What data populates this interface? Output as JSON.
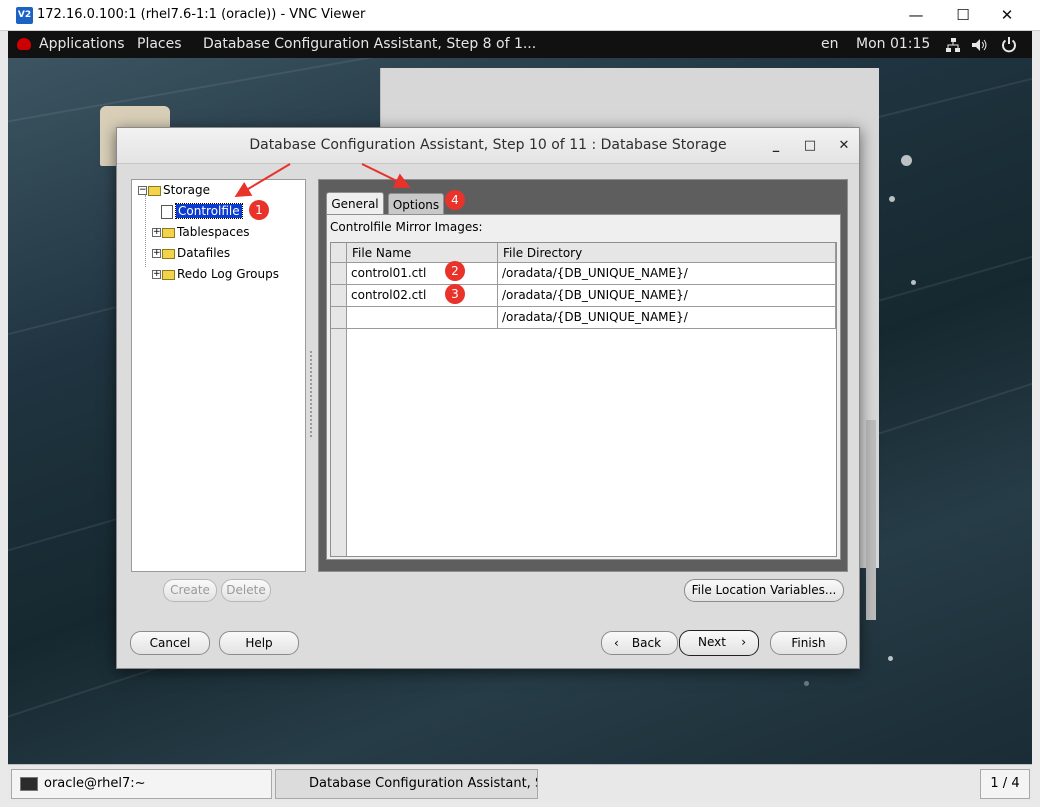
{
  "vnc": {
    "logo": "V2",
    "title": "172.16.0.100:1 (rhel7.6-1:1 (oracle)) - VNC Viewer",
    "controls": {
      "minimize": "—",
      "maximize": "☐",
      "close": "✕"
    }
  },
  "gnome": {
    "applications": "Applications",
    "places": "Places",
    "active_window": "Database Configuration Assistant, Step 8 of 1...",
    "lang": "en",
    "clock": "Mon 01:15",
    "icons": [
      "network-icon",
      "volume-icon",
      "power-icon"
    ]
  },
  "dialog": {
    "title": "Database Configuration Assistant, Step 10 of 11 : Database Storage",
    "controls": {
      "minimize": "_",
      "maximize": "□",
      "close": "✕"
    },
    "tree": {
      "root": "Storage",
      "items": [
        "Controlfile",
        "Tablespaces",
        "Datafiles",
        "Redo Log Groups"
      ]
    },
    "buttons": {
      "create": "Create",
      "delete": "Delete",
      "file_location": "File Location Variables...",
      "cancel": "Cancel",
      "help": "Help",
      "back": "Back",
      "next": "Next",
      "finish": "Finish"
    },
    "tabs": [
      "General",
      "Options"
    ],
    "mirror_label": "Controlfile Mirror Images:",
    "grid": {
      "columns": [
        "File Name",
        "File Directory"
      ],
      "rows": [
        {
          "name": "control01.ctl",
          "dir": "/oradata/{DB_UNIQUE_NAME}/"
        },
        {
          "name": "control02.ctl",
          "dir": "/oradata/{DB_UNIQUE_NAME}/"
        },
        {
          "name": "",
          "dir": "/oradata/{DB_UNIQUE_NAME}/"
        }
      ]
    }
  },
  "annotations": {
    "badges": [
      "1",
      "2",
      "3",
      "4"
    ],
    "color": "#e8322a"
  },
  "taskbar": {
    "terminal": "oracle@rhel7:~",
    "dbca": "Database Configuration Assistant, St...",
    "workspace": "1 / 4"
  }
}
